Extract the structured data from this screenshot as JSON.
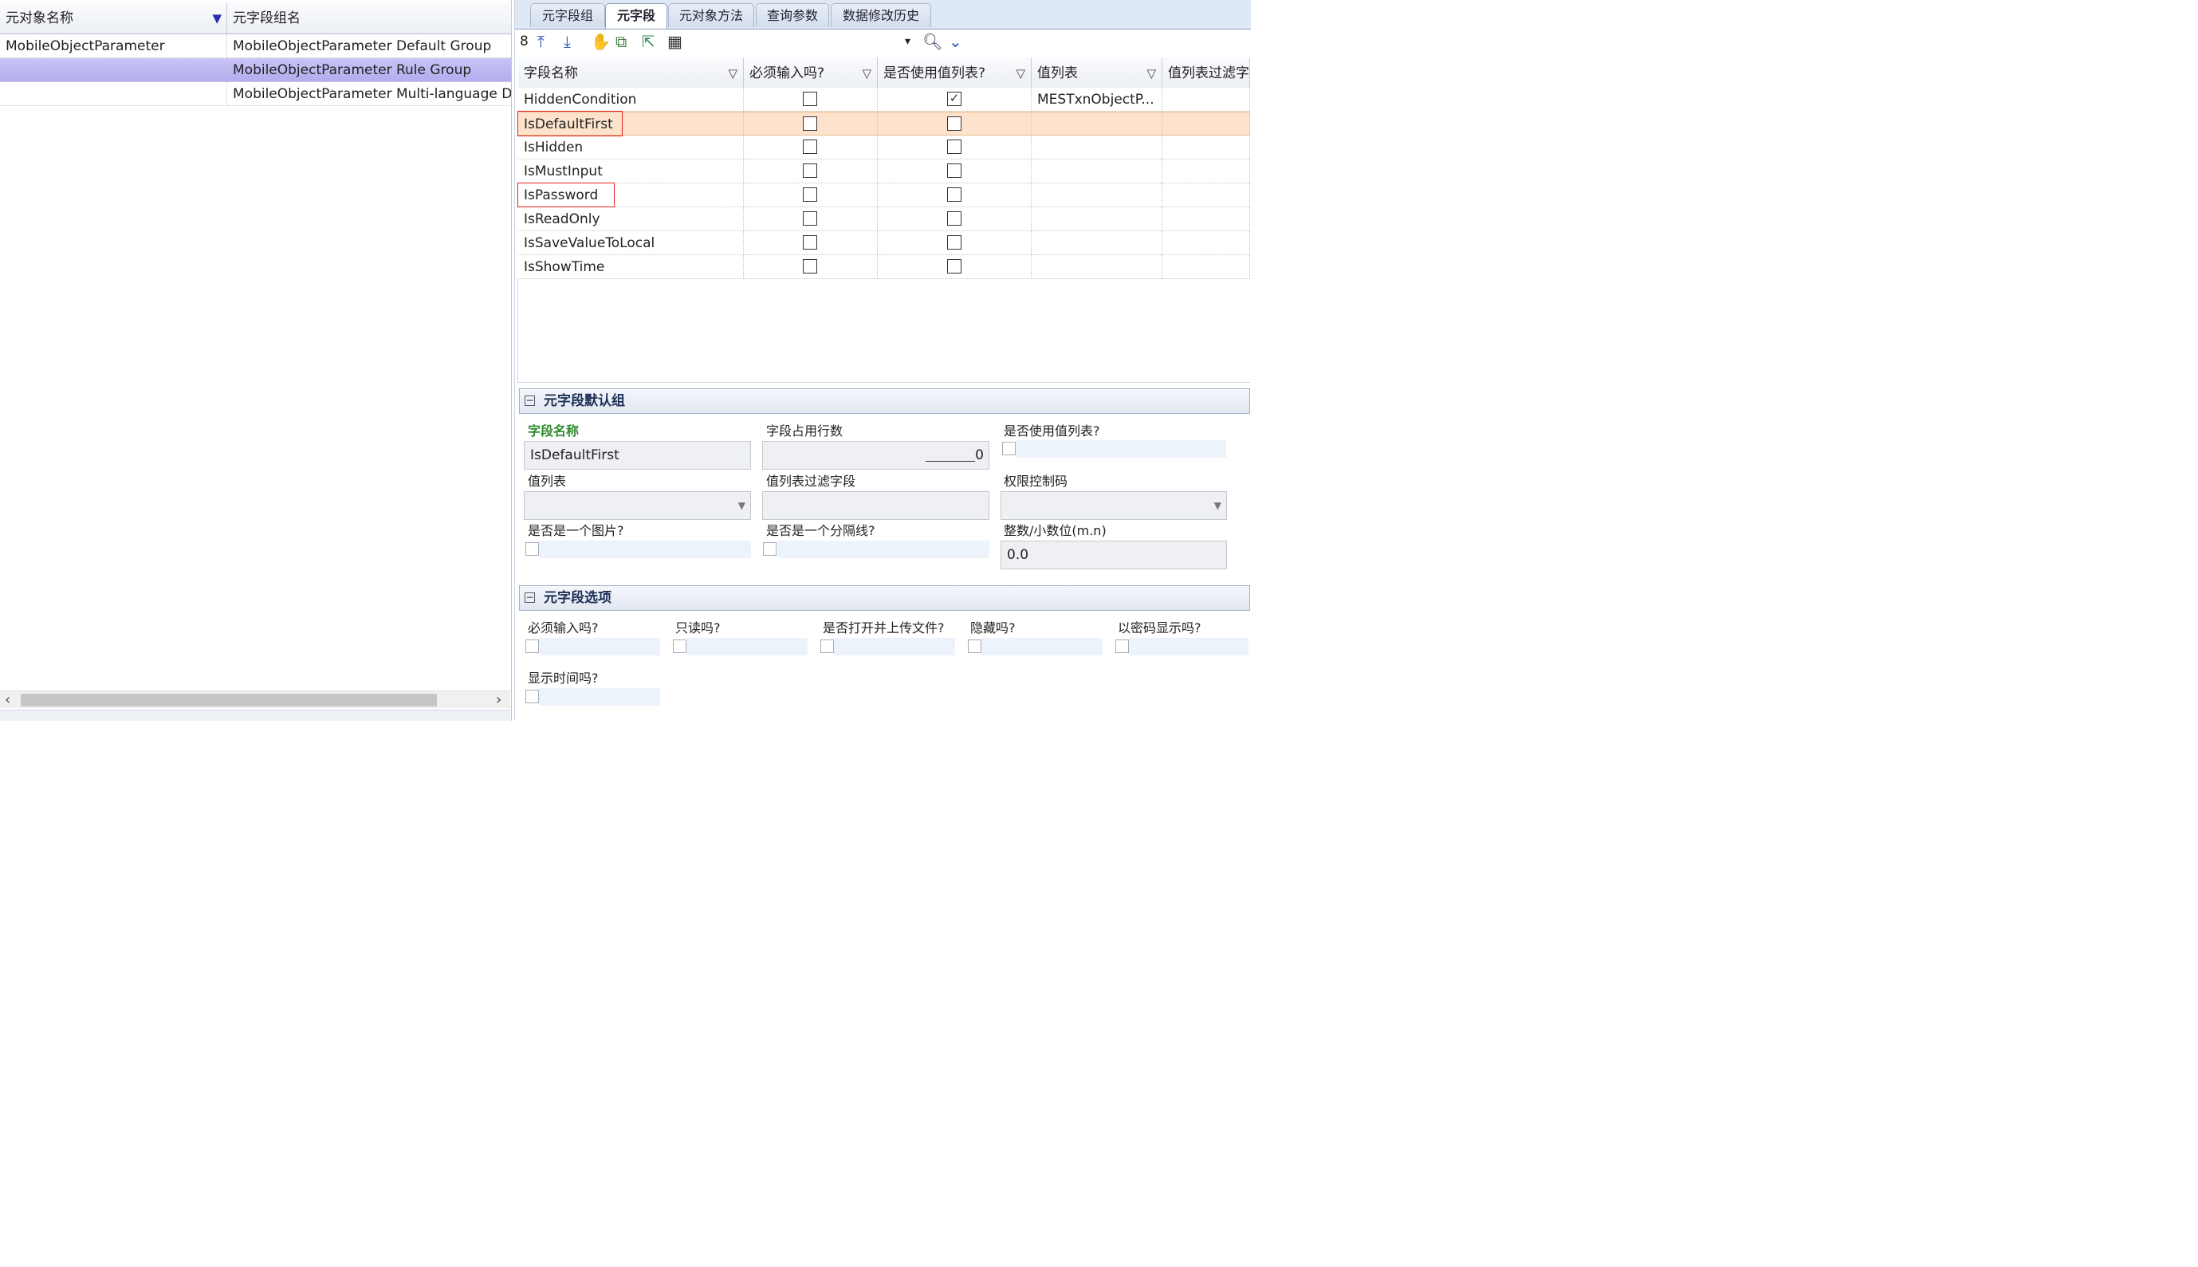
{
  "left_panel": {
    "col1_header": "元对象名称",
    "col2_header": "元字段组名",
    "rows": [
      {
        "obj": "MobileObjectParameter",
        "group": "MobileObjectParameter Default Group"
      },
      {
        "obj": "",
        "group": "MobileObjectParameter Rule Group"
      },
      {
        "obj": "",
        "group": "MobileObjectParameter Multi-language D"
      }
    ]
  },
  "tabs": [
    "元字段组",
    "元字段",
    "元对象方法",
    "查询参数",
    "数据修改历史"
  ],
  "toolbar": {
    "count": "8",
    "dropdown_value": ""
  },
  "grid": {
    "headers": [
      "字段名称",
      "必须输入吗?",
      "是否使用值列表?",
      "值列表",
      "值列表过滤字"
    ],
    "rows": [
      {
        "name": "HiddenCondition",
        "required": false,
        "use_list": true,
        "list": "MESTxnObjectP..."
      },
      {
        "name": "IsDefaultFirst",
        "required": false,
        "use_list": false,
        "list": ""
      },
      {
        "name": "IsHidden",
        "required": false,
        "use_list": false,
        "list": ""
      },
      {
        "name": "IsMustInput",
        "required": false,
        "use_list": false,
        "list": ""
      },
      {
        "name": "IsPassword",
        "required": false,
        "use_list": false,
        "list": ""
      },
      {
        "name": "IsReadOnly",
        "required": false,
        "use_list": false,
        "list": ""
      },
      {
        "name": "IsSaveValueToLocal",
        "required": false,
        "use_list": false,
        "list": ""
      },
      {
        "name": "IsShowTime",
        "required": false,
        "use_list": false,
        "list": ""
      }
    ]
  },
  "default_group": {
    "title": "元字段默认组",
    "field_name_label": "字段名称",
    "field_name_value": "IsDefaultFirst",
    "rows_label": "字段占用行数",
    "rows_value": "0",
    "use_list_label": "是否使用值列表?",
    "list_label": "值列表",
    "list_filter_label": "值列表过滤字段",
    "perm_label": "权限控制码",
    "is_image_label": "是否是一个图片?",
    "is_separator_label": "是否是一个分隔线?",
    "decimal_label": "整数/小数位(m.n)",
    "decimal_value": "0.0"
  },
  "options_group": {
    "title": "元字段选项",
    "required_label": "必须输入吗?",
    "readonly_label": "只读吗?",
    "upload_label": "是否打开并上传文件?",
    "hidden_label": "隐藏吗?",
    "password_label": "以密码显示吗?",
    "showtime_label": "显示时间吗?"
  },
  "colors": {
    "selection": "#b3acef",
    "highlight_row": "#fde3cc",
    "annotation": "#e02020"
  }
}
